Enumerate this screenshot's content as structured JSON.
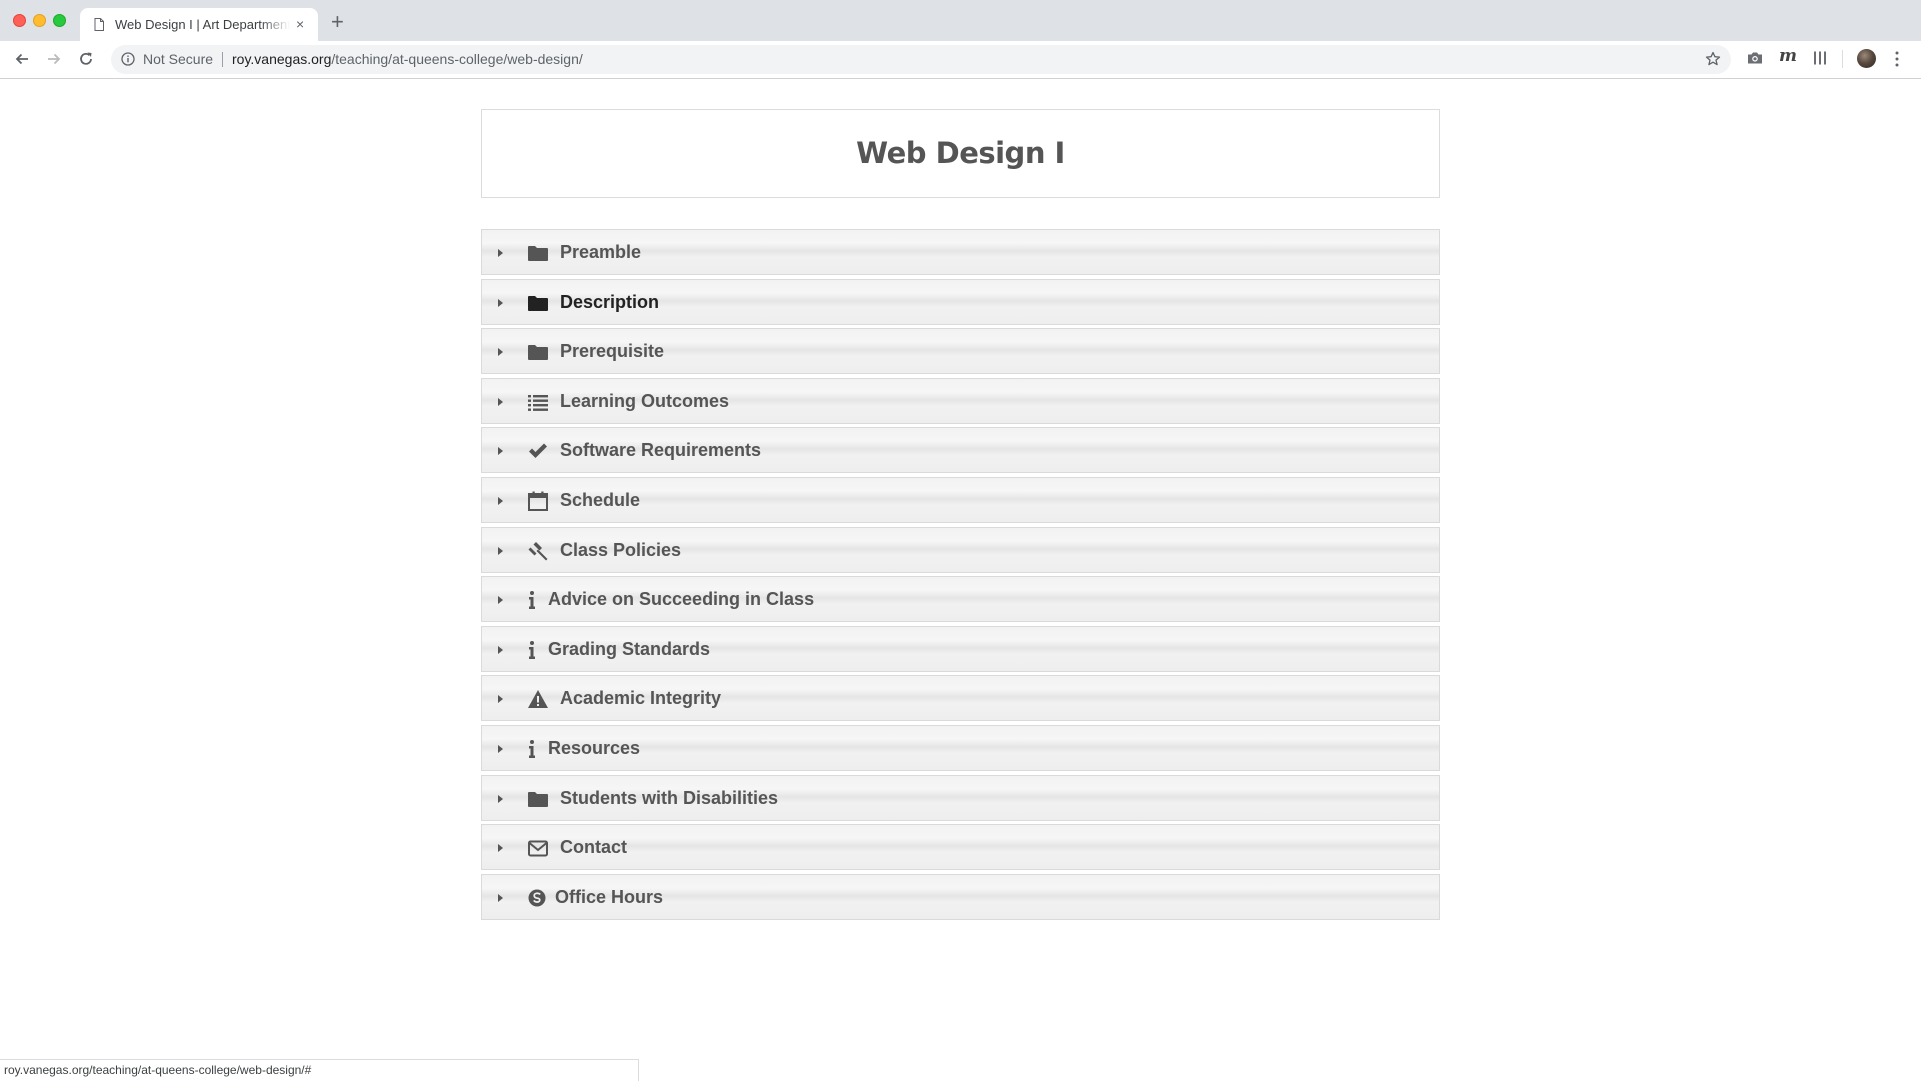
{
  "browser": {
    "tab_title": "Web Design I | Art Department",
    "new_tab_symbol": "+",
    "close_symbol": "×",
    "security_label": "Not Secure",
    "url_host": "roy.vanegas.org",
    "url_path": "/teaching/at-queens-college/web-design/",
    "extension_m": "m",
    "status_url": "roy.vanegas.org/teaching/at-queens-college/web-design/#"
  },
  "page": {
    "title": "Web Design I"
  },
  "sections": [
    {
      "label": "Preamble",
      "icon": "folder-icon"
    },
    {
      "label": "Description",
      "icon": "folder-icon",
      "active": true
    },
    {
      "label": "Prerequisite",
      "icon": "folder-icon"
    },
    {
      "label": "Learning Outcomes",
      "icon": "list-icon"
    },
    {
      "label": "Software Requirements",
      "icon": "checkmark-icon"
    },
    {
      "label": "Schedule",
      "icon": "calendar-icon"
    },
    {
      "label": "Class Policies",
      "icon": "gavel-icon"
    },
    {
      "label": "Advice on Succeeding in Class",
      "icon": "info-icon"
    },
    {
      "label": "Grading Standards",
      "icon": "info-icon"
    },
    {
      "label": "Academic Integrity",
      "icon": "warning-icon"
    },
    {
      "label": "Resources",
      "icon": "info-icon"
    },
    {
      "label": "Students with Disabilities",
      "icon": "folder-icon"
    },
    {
      "label": "Contact",
      "icon": "envelope-icon"
    },
    {
      "label": "Office Hours",
      "icon": "skype-icon"
    }
  ],
  "colors": {
    "text": "#555555",
    "text_active": "#222222",
    "panel_border": "#dadada"
  }
}
